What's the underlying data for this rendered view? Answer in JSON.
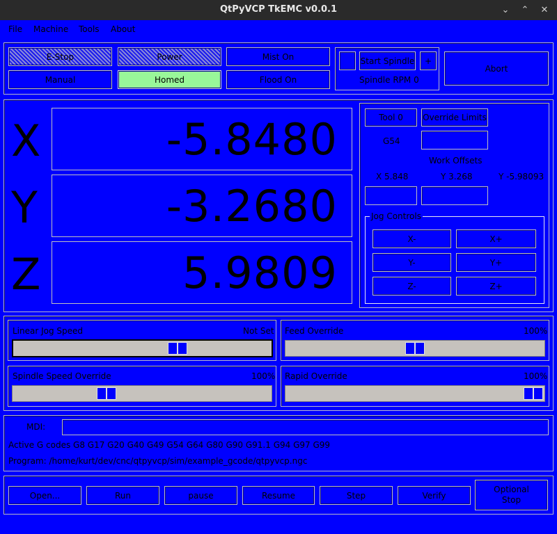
{
  "window": {
    "title": "QtPyVCP TkEMC v0.0.1",
    "minimize": "⌄",
    "restore": "⌃",
    "close": "✕"
  },
  "menu": {
    "file": "File",
    "machine": "Machine",
    "tools": "Tools",
    "about": "About"
  },
  "controls": {
    "estop": "E-Stop",
    "power": "Power",
    "mist": "Mist On",
    "manual": "Manual",
    "homed": "Homed",
    "flood": "Flood On",
    "spindle_dec": "",
    "start_spindle": "Start Spindle",
    "spindle_inc": "+",
    "spindle_rpm": "Spindle RPM 0",
    "abort": "Abort",
    "homed_color": "#99f799"
  },
  "dro": {
    "x_label": "X",
    "x_value": "-5.8480",
    "y_label": "Y",
    "y_value": "-3.2680",
    "z_label": "Z",
    "z_value": "5.9809"
  },
  "tools": {
    "tool": "Tool 0",
    "override_limits": "Override Limits",
    "wcs": "G54",
    "work_offsets": "Work Offsets",
    "x_offset": "X 5.848",
    "y_offset": "Y 3.268",
    "z_offset": "Y -5.98093"
  },
  "jog": {
    "title": "Jog Controls",
    "x_minus": "X-",
    "x_plus": "X+",
    "y_minus": "Y-",
    "y_plus": "Y+",
    "z_minus": "Z-",
    "z_plus": "Z+"
  },
  "sliders": {
    "linear_jog": {
      "label": "Linear Jog Speed",
      "value": "Not Set",
      "position": 0.65
    },
    "feed_override": {
      "label": "Feed Override",
      "value": "100%",
      "position": 0.5
    },
    "spindle_override": {
      "label": "Spindle Speed Override",
      "value": "100%",
      "position": 0.35
    },
    "rapid_override": {
      "label": "Rapid Override",
      "value": "100%",
      "position": 1.0
    }
  },
  "mdi": {
    "label": "MDI:",
    "active_gcodes": "Active G codes G8 G17 G20 G40 G49 G54 G64 G80 G90 G91.1 G94 G97 G99",
    "program": "Program:  /home/kurt/dev/cnc/qtpyvcp/sim/example_gcode/qtpyvcp.ngc"
  },
  "program_controls": {
    "open": "Open...",
    "run": "Run",
    "pause": "pause",
    "resume": "Resume",
    "step": "Step",
    "verify": "Verify",
    "optional_stop": "Optional\nStop"
  }
}
